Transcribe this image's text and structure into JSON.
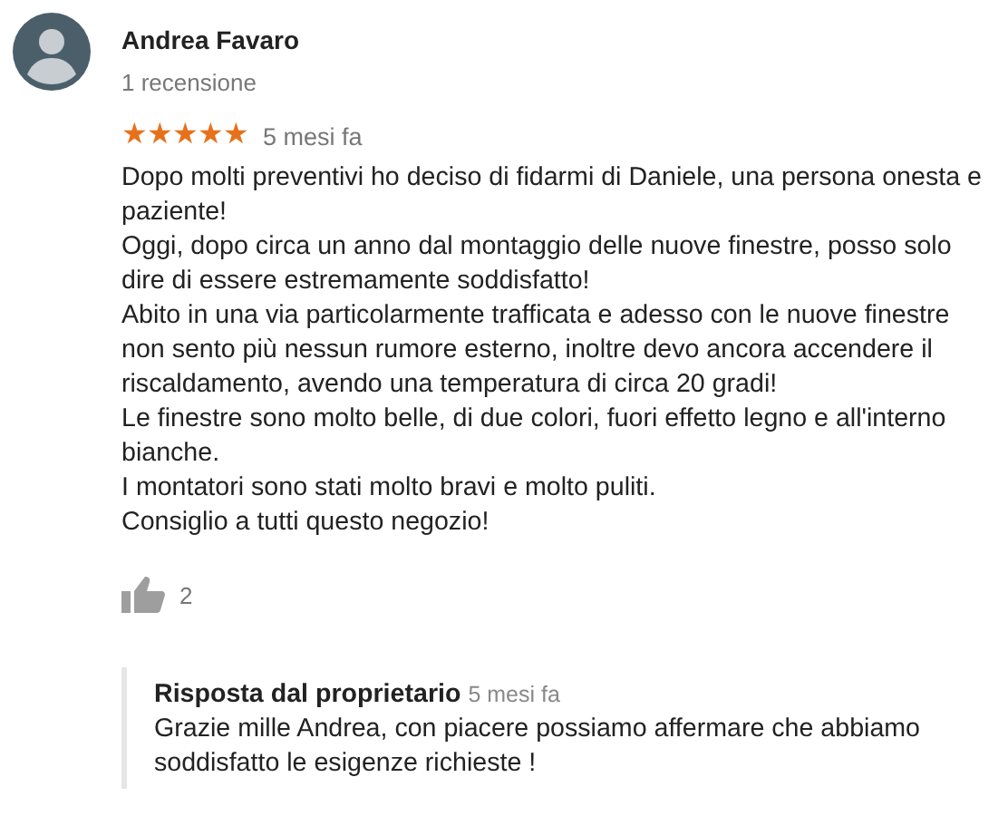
{
  "review": {
    "author": "Andrea Favaro",
    "review_count": "1 recensione",
    "stars": 5,
    "time": "5 mesi fa",
    "paragraphs": [
      "Dopo molti preventivi ho deciso di fidarmi di Daniele, una persona onesta e paziente!",
      "Oggi, dopo circa un anno dal montaggio delle nuove finestre, posso solo dire di essere estremamente soddisfatto!",
      "Abito in una via particolarmente trafficata e adesso con le nuove finestre non sento più nessun rumore esterno, inoltre devo ancora accendere il riscaldamento, avendo una temperatura di circa 20 gradi!",
      "Le finestre sono molto belle, di due colori, fuori effetto legno e all'interno bianche.",
      "I montatori sono stati molto bravi e molto puliti.",
      "Consiglio a tutti questo negozio!"
    ],
    "likes": "2"
  },
  "owner_reply": {
    "title": "Risposta dal proprietario",
    "time": "5 mesi fa",
    "text": "Grazie mille Andrea, con piacere possiamo affermare che abbiamo soddisfatto le esigenze richieste !"
  }
}
